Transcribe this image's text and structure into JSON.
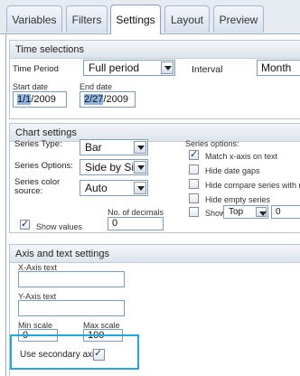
{
  "tabs": [
    "Variables",
    "Filters",
    "Settings",
    "Layout",
    "Preview"
  ],
  "active_tab": "Settings",
  "time_selections": {
    "title": "Time selections",
    "time_period_label": "Time Period",
    "time_period_value": "Full period",
    "interval_label": "Interval",
    "interval_value": "Month",
    "start_date_label": "Start date",
    "start_date_sel": "1/1",
    "start_date_rest": "/2009",
    "end_date_label": "End date",
    "end_date_sel": "2/27",
    "end_date_rest": "/2009"
  },
  "chart_settings": {
    "title": "Chart settings",
    "series_type_label": "Series Type:",
    "series_type_value": "Bar",
    "series_options_label": "Series Options:",
    "series_options_value": "Side by Side",
    "series_color_label_1": "Series color",
    "series_color_label_2": "source:",
    "series_color_value": "Auto",
    "series_opts_header": "Series options:",
    "match_x_axis": "Match x-axis on text",
    "hide_date_gaps": "Hide date gaps",
    "hide_compare": "Hide compare series with no d",
    "hide_empty": "Hide empty series",
    "show_label": "Show",
    "show_select": "Top",
    "show_count": "0",
    "show_values": "Show values",
    "decimals_label": "No. of decimals",
    "decimals_value": "0"
  },
  "axis_settings": {
    "title": "Axis and text settings",
    "x_axis_label": "X-Axis text",
    "x_axis_value": "",
    "y_axis_label": "Y-Axis text",
    "y_axis_value": "",
    "min_scale_label": "Min scale",
    "min_scale_value": "0",
    "max_scale_label": "Max scale",
    "max_scale_value": "100",
    "secondary_axis_label": "Use secondary axis"
  },
  "accent": "#22a7e0"
}
